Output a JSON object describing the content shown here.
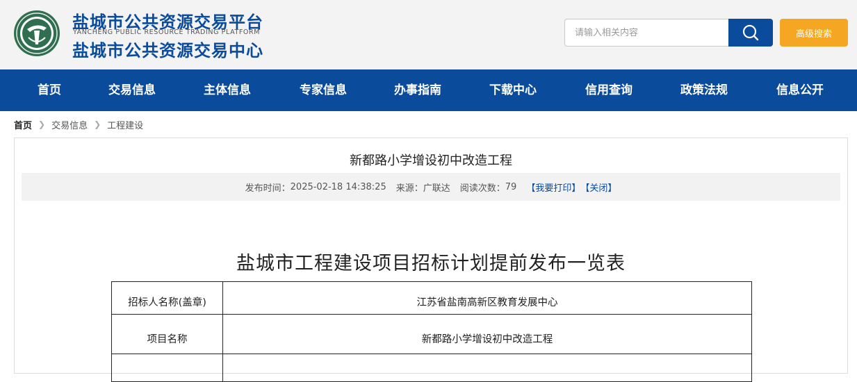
{
  "header": {
    "title_main": "盐城市公共资源交易平台",
    "subtitle_en": "YANCHENG PUBLIC RESOURCE TRADING PLATFORM",
    "title_center": "盐城市公共资源交易中心",
    "logo_icon": "site-logo-emblem",
    "brand_color": "#0b4b9c",
    "accent_color": "#f5a623"
  },
  "search": {
    "placeholder": "请输入相关内容",
    "value": "",
    "search_icon": "search-icon",
    "advanced_label": "高级搜索"
  },
  "nav": {
    "items": [
      {
        "label": "首页"
      },
      {
        "label": "交易信息"
      },
      {
        "label": "主体信息"
      },
      {
        "label": "专家信息"
      },
      {
        "label": "办事指南"
      },
      {
        "label": "下载中心"
      },
      {
        "label": "信用查询"
      },
      {
        "label": "政策法规"
      },
      {
        "label": "信息公开"
      }
    ]
  },
  "breadcrumb": {
    "items": [
      "首页",
      "交易信息",
      "工程建设"
    ],
    "separator_icon": "chevron-right-icon"
  },
  "article": {
    "title": "新都路小学增设初中改造工程",
    "meta": {
      "publish_time_label": "发布时间：",
      "publish_time": "2025-02-18 14:38:25",
      "source_label": "来源：",
      "source": "广联达",
      "views_label": "阅读次数：",
      "views": "79",
      "print_label": "【我要打印】",
      "close_label": "【关闭】"
    },
    "document": {
      "title": "盐城市工程建设项目招标计划提前发布一览表",
      "rows": [
        {
          "label": "招标人名称(盖章)",
          "value": "江苏省盐南高新区教育发展中心"
        },
        {
          "label": "项目名称",
          "value": "新都路小学增设初中改造工程"
        },
        {
          "label": "",
          "value": ""
        }
      ]
    }
  }
}
